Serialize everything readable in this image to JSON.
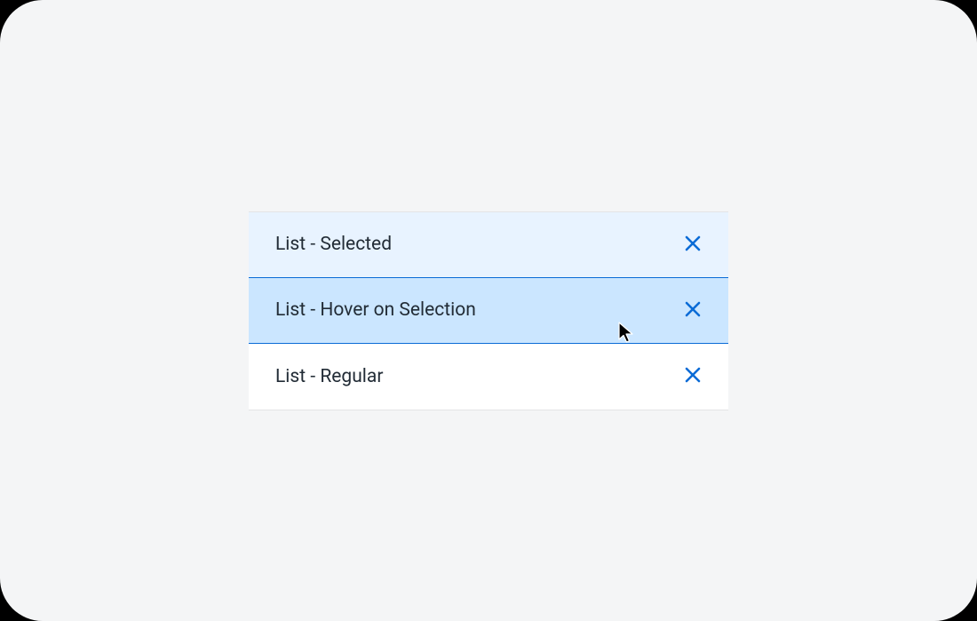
{
  "list": {
    "items": [
      {
        "label": "List - Selected",
        "state": "selected"
      },
      {
        "label": "List - Hover on Selection",
        "state": "hover-selected"
      },
      {
        "label": "List - Regular",
        "state": "regular"
      }
    ]
  },
  "colors": {
    "accent": "#0a6bd6",
    "selected_bg": "#e8f3ff",
    "hover_selected_bg": "#cbe6ff",
    "text": "#222c36"
  }
}
